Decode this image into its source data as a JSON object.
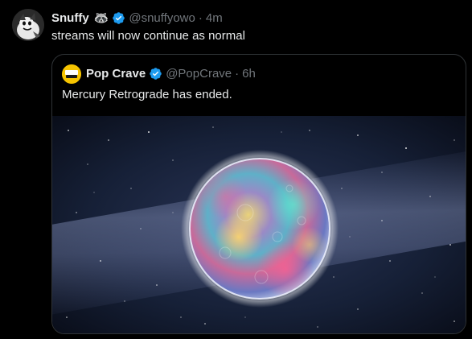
{
  "tweet": {
    "author_name": "Snuffy",
    "author_emoji": "🦝",
    "handle": "@snuffyowo",
    "separator": "·",
    "time": "4m",
    "text": "streams will now continue as normal",
    "avatar_icon": "cartoon-avatar-icon"
  },
  "quoted_tweet": {
    "author_name": "Pop Crave",
    "handle": "@PopCrave",
    "separator": "·",
    "time": "6h",
    "text": "Mercury Retrograde has ended.",
    "avatar_logo_text": "POP CRAVE",
    "media_description_icon": "planet-mercury-image"
  },
  "colors": {
    "background": "#000000",
    "text_primary": "#e7e9ea",
    "text_secondary": "#71767b",
    "border": "#2f3336",
    "verified_blue": "#1d9bf0",
    "pop_crave_yellow": "#f6c400"
  }
}
